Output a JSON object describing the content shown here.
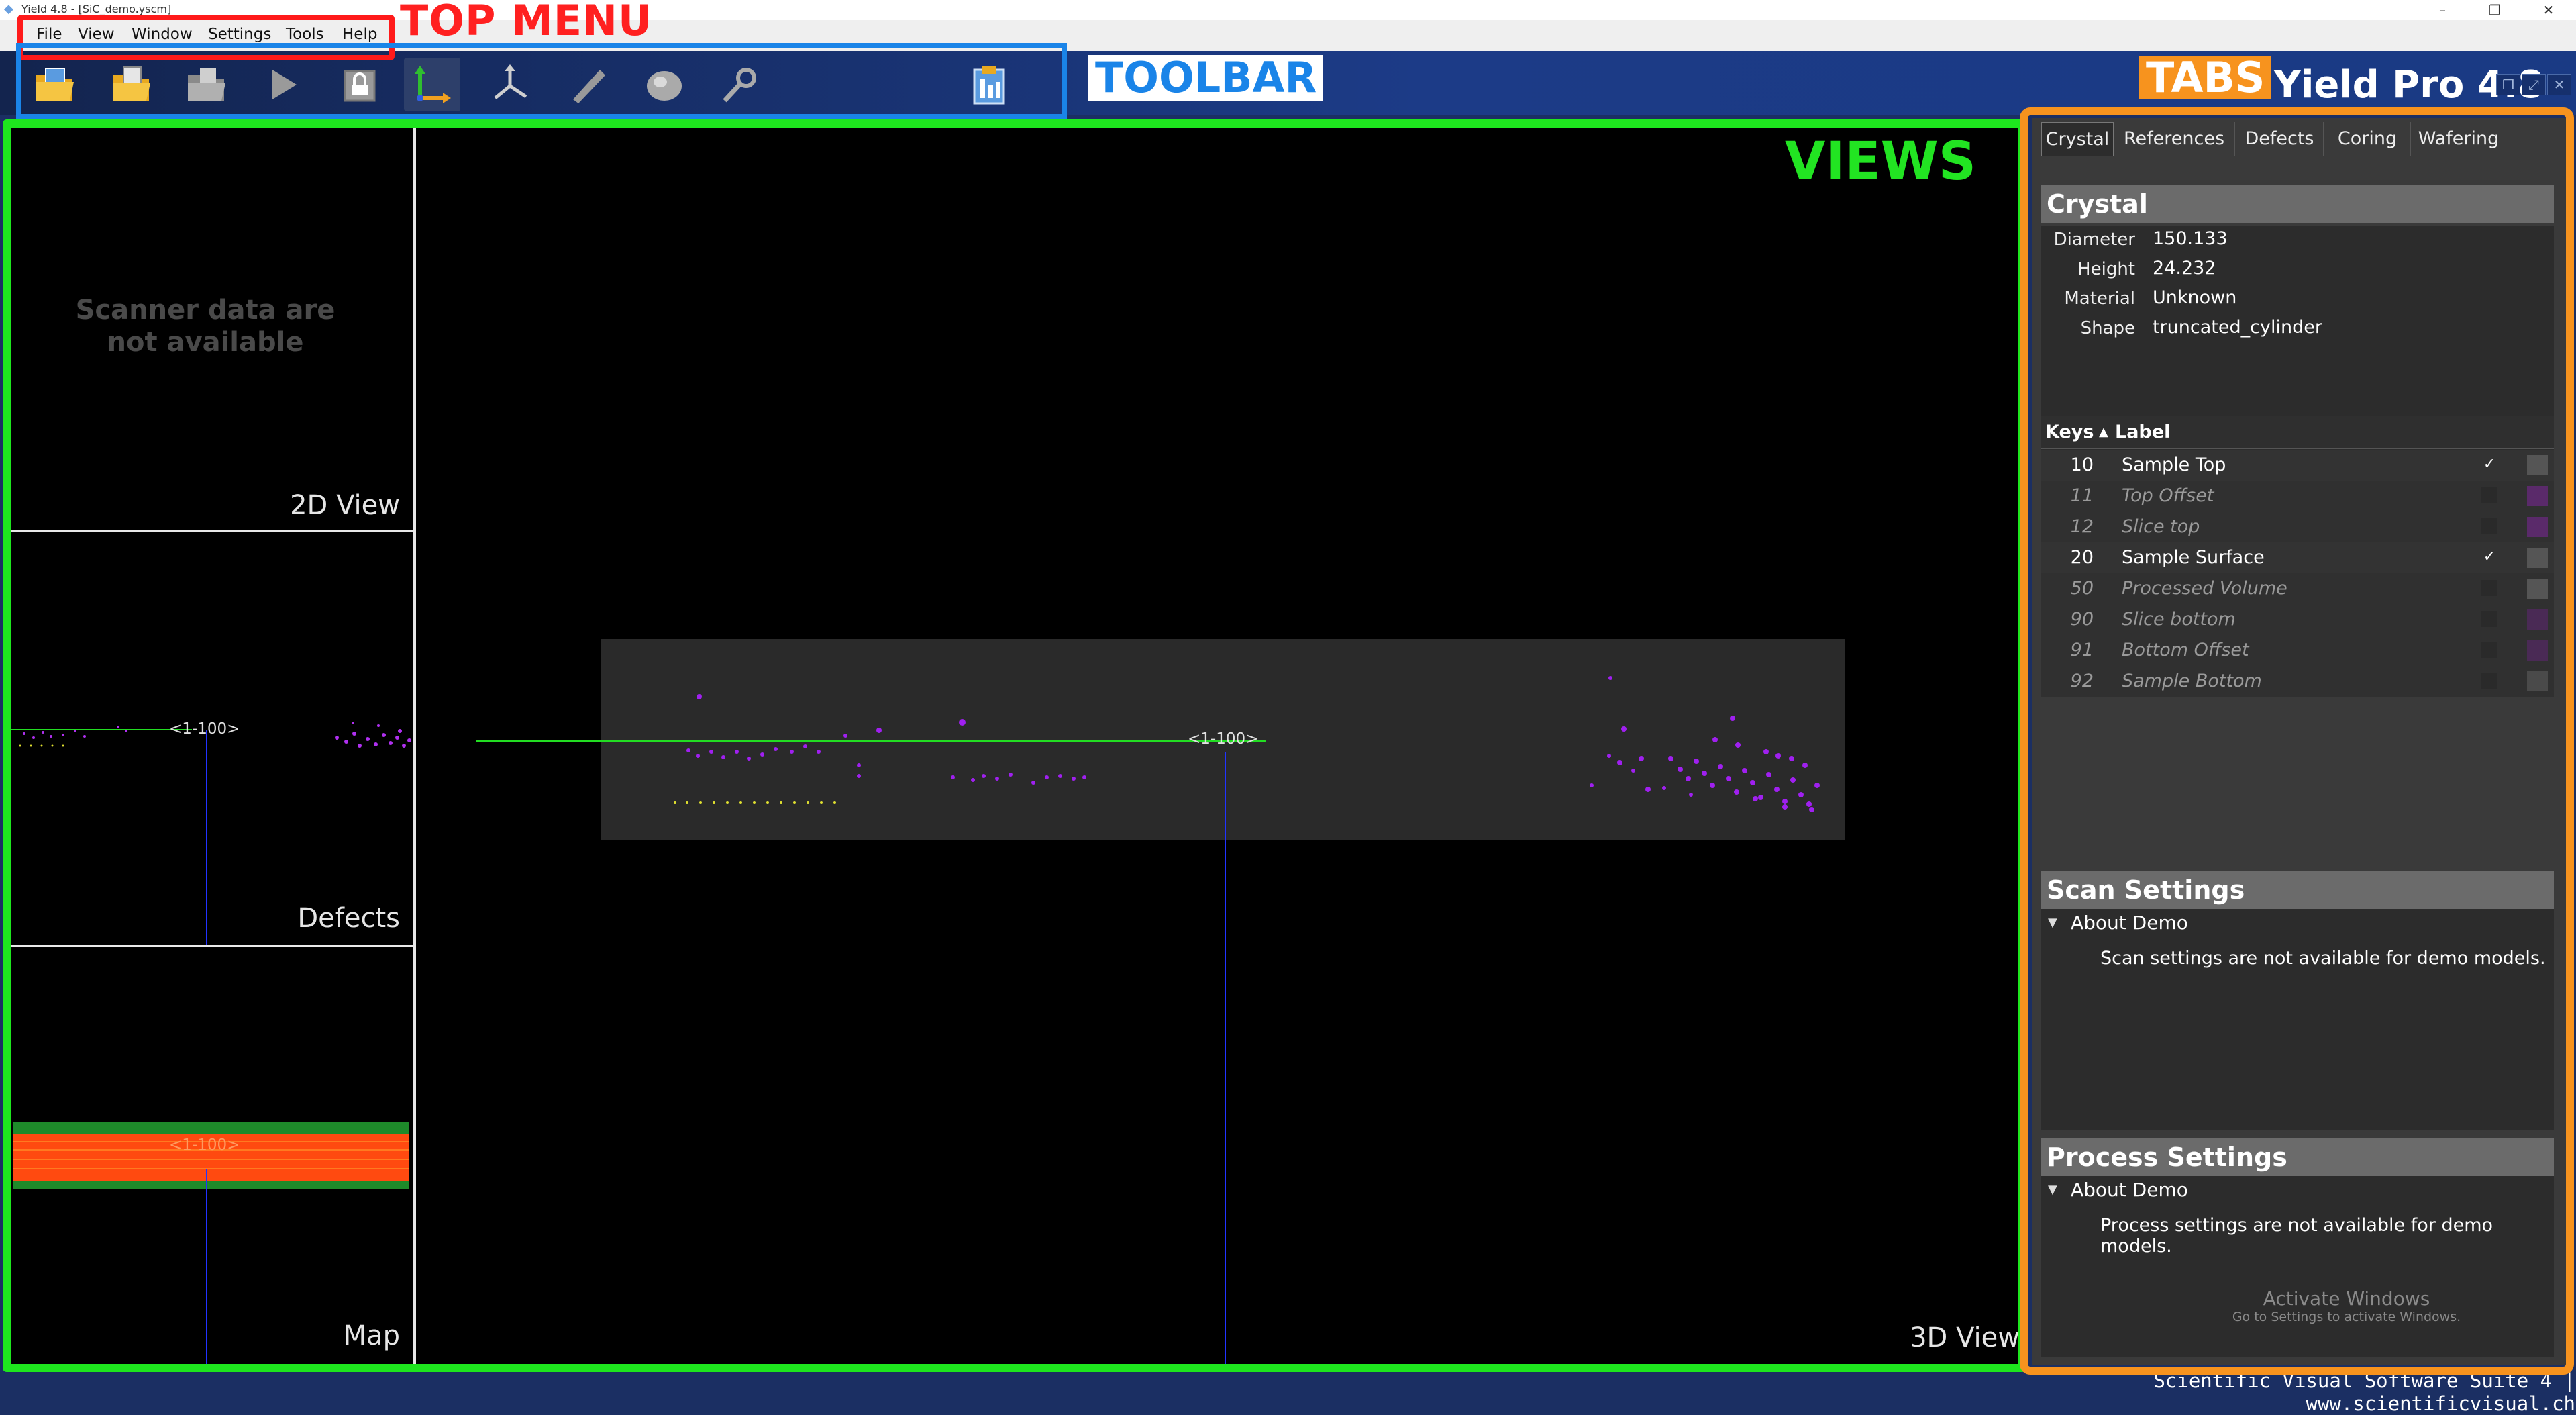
{
  "window": {
    "title": "Yield 4.8 - [SiC_demo.yscm]"
  },
  "menu": {
    "items": [
      "File",
      "View",
      "Window",
      "Settings",
      "Tools",
      "Help"
    ]
  },
  "toolbar": {
    "buttons": [
      "open-project-icon",
      "open-folder-icon",
      "open-file-icon",
      "play-icon",
      "lock-icon",
      "axes-icon",
      "rotate-axes-icon",
      "measure-ruler-icon",
      "ellipsoid-icon",
      "tools-wrench-icon",
      "clipboard-report-icon"
    ]
  },
  "brand": {
    "app_name": "Yield Pro 4.8"
  },
  "annotations": {
    "top_menu": "TOP MENU",
    "toolbar": "TOOLBAR",
    "tabs": "TABS",
    "views": "VIEWS"
  },
  "views": {
    "scanner_msg_line1": "Scanner data are",
    "scanner_msg_line2": "not available",
    "view_2d": "2D View",
    "view_defects": "Defects",
    "view_map": "Map",
    "view_3d": "3D View",
    "plane_label": "<1-100>"
  },
  "tabs": [
    "Crystal",
    "References",
    "Defects",
    "Coring",
    "Wafering"
  ],
  "crystal": {
    "header": "Crystal",
    "properties": [
      {
        "key": "Diameter",
        "value": "150.133"
      },
      {
        "key": "Height",
        "value": "24.232"
      },
      {
        "key": "Material",
        "value": "Unknown"
      },
      {
        "key": "Shape",
        "value": "truncated_cylinder"
      }
    ]
  },
  "keys_table": {
    "col_keys": "Keys",
    "col_label": "Label",
    "rows": [
      {
        "key": "10",
        "label": "Sample Top",
        "enabled": true,
        "checked": true,
        "color": "#555555"
      },
      {
        "key": "11",
        "label": "Top Offset",
        "enabled": false,
        "checked": false,
        "color": "#5a2a6a"
      },
      {
        "key": "12",
        "label": "Slice top",
        "enabled": false,
        "checked": false,
        "color": "#5a2a6a"
      },
      {
        "key": "20",
        "label": "Sample Surface",
        "enabled": true,
        "checked": true,
        "color": "#555555"
      },
      {
        "key": "50",
        "label": "Processed Volume",
        "enabled": false,
        "checked": false,
        "color": "#555555"
      },
      {
        "key": "90",
        "label": "Slice bottom",
        "enabled": false,
        "checked": false,
        "color": "#4a2a55"
      },
      {
        "key": "91",
        "label": "Bottom Offset",
        "enabled": false,
        "checked": false,
        "color": "#4a2a55"
      },
      {
        "key": "92",
        "label": "Sample Bottom",
        "enabled": false,
        "checked": false,
        "color": "#4a4a4a"
      }
    ]
  },
  "scan_settings": {
    "header": "Scan Settings",
    "group": "About Demo",
    "note": "Scan settings are not available for demo models."
  },
  "process_settings": {
    "header": "Process Settings",
    "group": "About Demo",
    "note": "Process settings are not available for demo models."
  },
  "watermark": {
    "line1": "Activate Windows",
    "line2": "Go to Settings to activate Windows."
  },
  "footer": "Scientific Visual Software Suite 4 | www.scientificvisual.ch",
  "colors": {
    "accent_topmenu": "#ff2020",
    "accent_toolbar": "#1a84e8",
    "accent_views": "#1ee61e",
    "accent_tabs": "#f7931e",
    "defect_purple": "#a020f0"
  }
}
